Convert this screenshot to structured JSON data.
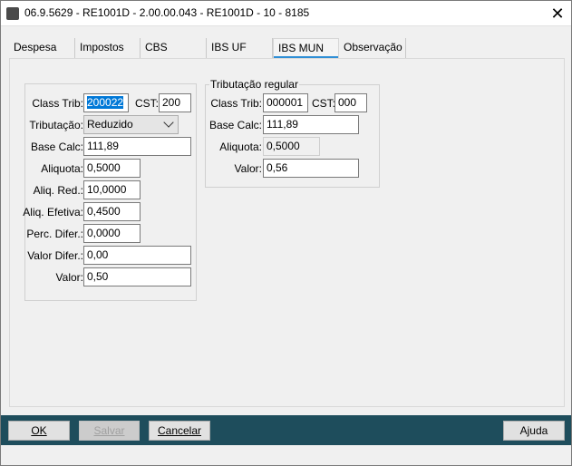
{
  "window": {
    "title": "06.9.5629 - RE1001D - 2.00.00.043 - RE1001D - 10 - 8185"
  },
  "tabs": [
    {
      "label": "Despesa"
    },
    {
      "label": "Impostos"
    },
    {
      "label": "CBS"
    },
    {
      "label": "IBS UF"
    },
    {
      "label": "IBS MUN"
    },
    {
      "label": "Observação"
    }
  ],
  "left_group": {
    "class_trib_label": "Class Trib:",
    "class_trib_value": "200022",
    "cst_label": "CST:",
    "cst_value": "200",
    "tributacao_label": "Tributação:",
    "tributacao_value": "Reduzido",
    "base_calc_label": "Base Calc:",
    "base_calc_value": "111,89",
    "aliquota_label": "Aliquota:",
    "aliquota_value": "0,5000",
    "aliq_red_label": "Aliq. Red.:",
    "aliq_red_value": "10,0000",
    "aliq_efetiva_label": "Aliq. Efetiva:",
    "aliq_efetiva_value": "0,4500",
    "perc_difer_label": "Perc. Difer.:",
    "perc_difer_value": "0,0000",
    "valor_difer_label": "Valor Difer.:",
    "valor_difer_value": "0,00",
    "valor_label": "Valor:",
    "valor_value": "0,50"
  },
  "right_group": {
    "title": "Tributação regular",
    "class_trib_label": "Class Trib:",
    "class_trib_value": "000001",
    "cst_label": "CST:",
    "cst_value": "000",
    "base_calc_label": "Base Calc:",
    "base_calc_value": "111,89",
    "aliquota_label": "Aliquota:",
    "aliquota_value": "0,5000",
    "valor_label": "Valor:",
    "valor_value": "0,56"
  },
  "buttons": {
    "ok": "OK",
    "salvar": "Salvar",
    "cancelar": "Cancelar",
    "ajuda": "Ajuda"
  },
  "colors": {
    "bottom_bar": "#1e4d5c",
    "active_tab_underline": "#2f8fd6",
    "selection": "#0078d7"
  }
}
